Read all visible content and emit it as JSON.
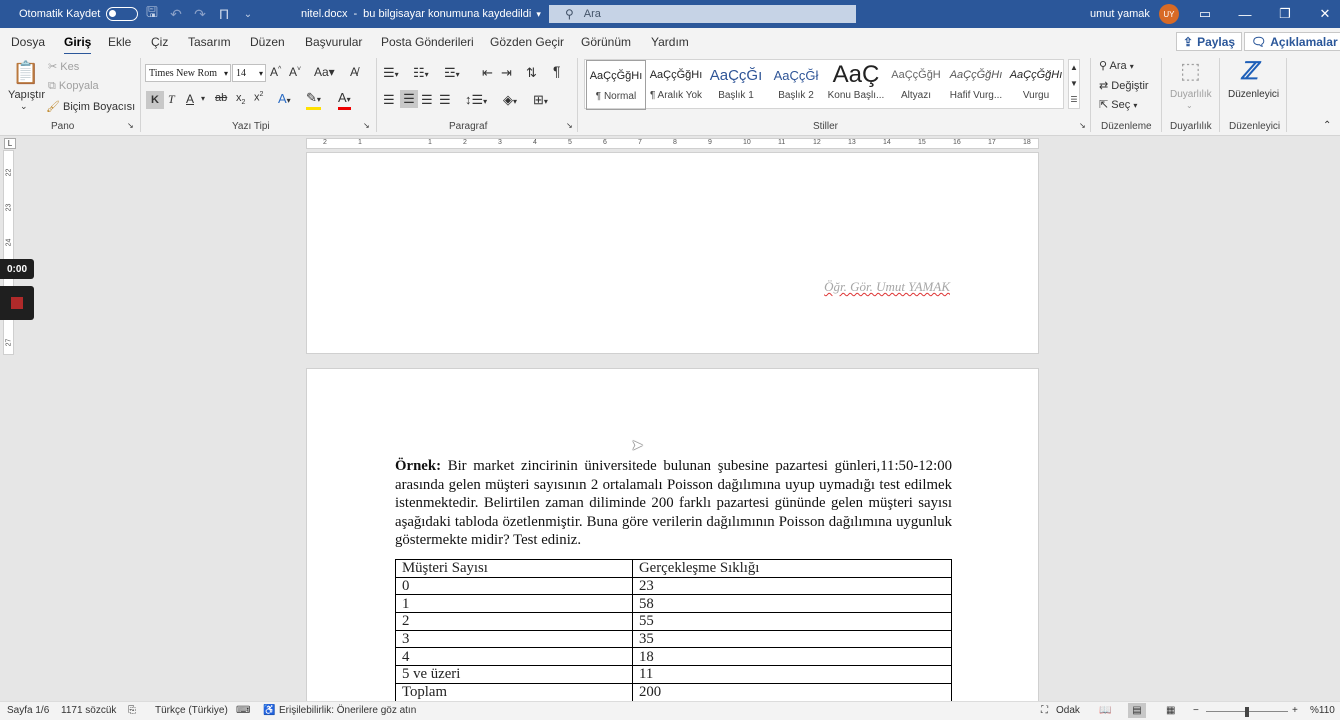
{
  "titlebar": {
    "autosave_label": "Otomatik Kaydet",
    "doc_title": "nitel.docx",
    "save_status": "bu bilgisayar konumuna kaydedildi",
    "search_placeholder": "Ara",
    "user_name": "umut yamak",
    "user_initials": "UY"
  },
  "menu": {
    "items": [
      "Dosya",
      "Giriş",
      "Ekle",
      "Çiz",
      "Tasarım",
      "Düzen",
      "Başvurular",
      "Posta Gönderileri",
      "Gözden Geçir",
      "Görünüm",
      "Yardım"
    ],
    "active": "Giriş",
    "share_label": "Paylaş",
    "comments_label": "Açıklamalar"
  },
  "ribbon": {
    "clipboard": {
      "paste": "Yapıştır",
      "cut": "Kes",
      "copy": "Kopyala",
      "format_painter": "Biçim Boyacısı",
      "label": "Pano"
    },
    "font": {
      "family": "Times New Rom",
      "size": "14",
      "label": "Yazı Tipi",
      "bold": "K",
      "italic": "T",
      "underline": "A"
    },
    "paragraph": {
      "label": "Paragraf"
    },
    "styles": {
      "items": [
        {
          "preview": "AaÇçĞğHı",
          "label": "¶ Normal"
        },
        {
          "preview": "AaÇçĞğHı",
          "label": "¶ Aralık Yok"
        },
        {
          "preview": "AaÇçĞı",
          "label": "Başlık 1"
        },
        {
          "preview": "AaÇçĞł",
          "label": "Başlık 2"
        },
        {
          "preview": "AaÇ",
          "label": "Konu Başlı..."
        },
        {
          "preview": "AaÇçĞğH",
          "label": "Altyazı"
        },
        {
          "preview": "AaÇçĞğHı",
          "label": "Hafif Vurg..."
        },
        {
          "preview": "AaÇçĞğHı",
          "label": "Vurgu"
        }
      ],
      "label": "Stiller"
    },
    "editing": {
      "find": "Ara",
      "replace": "Değiştir",
      "select": "Seç",
      "label": "Düzenleme"
    },
    "sensitivity": {
      "button": "Duyarlılık",
      "label": "Duyarlılık"
    },
    "editor": {
      "button": "Düzenleyici",
      "label": "Düzenleyici"
    }
  },
  "recording": {
    "time": "0:00"
  },
  "document": {
    "footer_name": "Öğr. Gör. Umut YAMAK",
    "example_label": "Örnek:",
    "paragraph": " Bir market zincirinin üniversitede bulunan şubesine pazartesi günleri,11:50-12:00 arasında gelen müşteri sayısının 2 ortalamalı Poisson dağılımına uyup uymadığı test edilmek istenmektedir. Belirtilen zaman diliminde 200 farklı pazartesi gününde gelen müşteri sayısı aşağıdaki tabloda özetlenmiştir. Buna göre verilerin dağılımının Poisson dağılımına uygunluk göstermekte midir? Test ediniz.",
    "table": {
      "headers": [
        "Müşteri Sayısı",
        "Gerçekleşme Sıklığı"
      ],
      "rows": [
        [
          "0",
          "23"
        ],
        [
          "1",
          "58"
        ],
        [
          "2",
          "55"
        ],
        [
          "3",
          "35"
        ],
        [
          "4",
          "18"
        ],
        [
          "5 ve üzeri",
          "11"
        ],
        [
          "Toplam",
          "200"
        ]
      ]
    }
  },
  "status": {
    "page": "Sayfa 1/6",
    "words": "1171 sözcük",
    "language": "Türkçe (Türkiye)",
    "accessibility": "Erişilebilirlik: Önerilere göz atın",
    "focus": "Odak",
    "zoom": "%110"
  }
}
